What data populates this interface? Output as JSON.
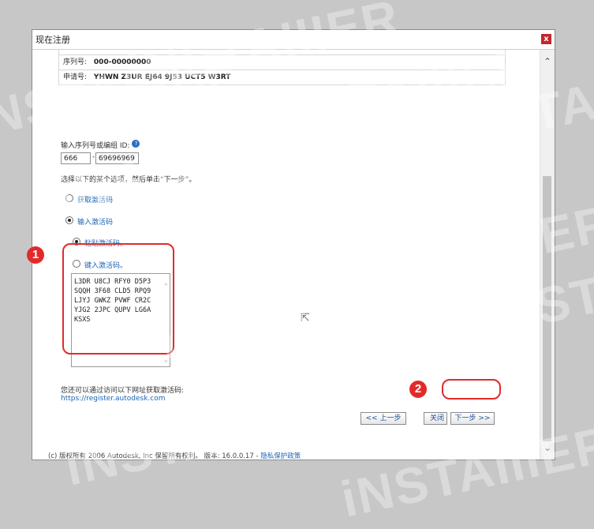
{
  "window": {
    "title": "现在注册",
    "close_glyph": "x"
  },
  "info_table": {
    "rows": [
      {
        "label": "序列号:",
        "value": "000-00000000"
      },
      {
        "label": "申请号:",
        "value": "YHWN Z3UR EJ64 9J53 UCT5 W3RT"
      }
    ]
  },
  "serial": {
    "label": "输入序列号或编组 ID:",
    "help_glyph": "?",
    "prefix": "666",
    "dash": "-",
    "number": "69696969"
  },
  "instruction": "选择以下的某个选项，然后单击“下一步”。",
  "options": {
    "get_code": "获取激活码",
    "enter_code": "输入激活码",
    "paste_code": "粘贴激活码。",
    "type_code": "键入激活码。"
  },
  "activation_code": {
    "lines": [
      "L3DR U8CJ RFY0 D5P3",
      "SQQH 3F68 CLD5 RPQ9",
      "LJYJ GWKZ PVWF CR2C",
      "YJG2 2JPC QUPV LG6A",
      "KSXS"
    ]
  },
  "help_text": "您还可以通过访问以下网址获取激活码:",
  "register_url": "https://register.autodesk.com",
  "buttons": {
    "back": "<< 上一步",
    "close": "关闭",
    "next": "下一步 >>"
  },
  "badges": {
    "one": "1",
    "two": "2"
  },
  "footer": {
    "text": "(c) 版权所有 2006 Autodesk, Inc 保留所有权利。 版本: 16.0.0.17 - ",
    "privacy_link": "隐私保护政策"
  },
  "watermark_text": "iNSTAIIIER",
  "colors": {
    "highlight": "#e32a2a",
    "link": "#1c64b5",
    "close_button": "#c1272d"
  }
}
